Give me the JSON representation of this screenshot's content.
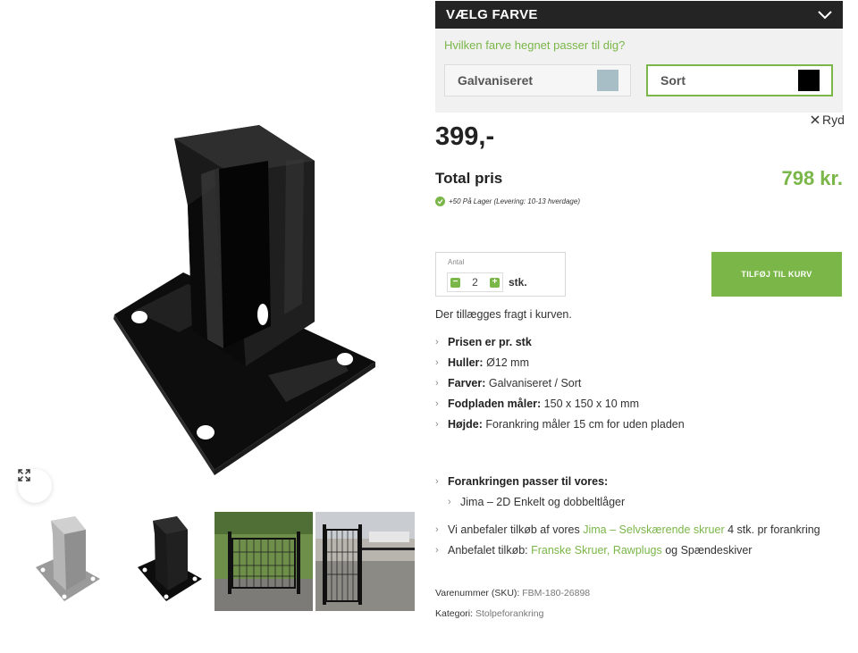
{
  "gallery": {
    "zoom_icon": "expand-arrows-icon",
    "thumbnails": [
      "galvanized-post-anchor",
      "black-post-anchor",
      "black-gate-garden",
      "black-gate-driveway"
    ]
  },
  "color_selector": {
    "title": "VÆLG FARVE",
    "question": "Hvilken farve hegnet passer til dig?",
    "options": [
      {
        "label": "Galvaniseret",
        "color": "#a8bec7",
        "selected": false
      },
      {
        "label": "Sort",
        "color": "#000000",
        "selected": true
      }
    ],
    "clear_label": "Ryd"
  },
  "price": "399,-",
  "total": {
    "label": "Total pris",
    "value": "798 kr."
  },
  "stock_text": "+50 På Lager (Levering: 10-13 hverdage)",
  "quantity": {
    "label": "Antal",
    "value": "2",
    "unit": "stk."
  },
  "add_to_cart_label": "TILFØJ TIL KURV",
  "shipping_note": "Der tillægges fragt i kurven.",
  "features": [
    {
      "label": "Prisen er pr. stk",
      "value": ""
    },
    {
      "label": "Huller:",
      "value": "Ø12 mm"
    },
    {
      "label": "Farver:",
      "value": "Galvaniseret / Sort"
    },
    {
      "label": "Fodpladen måler:",
      "value": "150 x 150 x 10 mm"
    },
    {
      "label": "Højde:",
      "value": "Forankring måler 15 cm for uden pladen"
    }
  ],
  "fits": {
    "heading": "Forankringen passer til vores:",
    "item": "Jima – 2D Enkelt og dobbeltlåger"
  },
  "recommendations": {
    "row1_prefix": "Vi anbefaler tilkøb af vores ",
    "row1_link": "Jima – Selvskærende skruer",
    "row1_suffix": " 4 stk. pr forankring",
    "row2_prefix": "Anbefalet tilkøb: ",
    "row2_link1": "Franske Skruer",
    "row2_sep": ", ",
    "row2_link2": "Rawplugs",
    "row2_suffix": " og Spændeskiver"
  },
  "sku": {
    "label": "Varenummer (SKU):",
    "value": "FBM-180-26898"
  },
  "category": {
    "label": "Kategori:",
    "value": "Stolpeforankring"
  },
  "colors": {
    "accent": "#7ab648",
    "dark": "#242424",
    "panel": "#f1f1f1"
  }
}
